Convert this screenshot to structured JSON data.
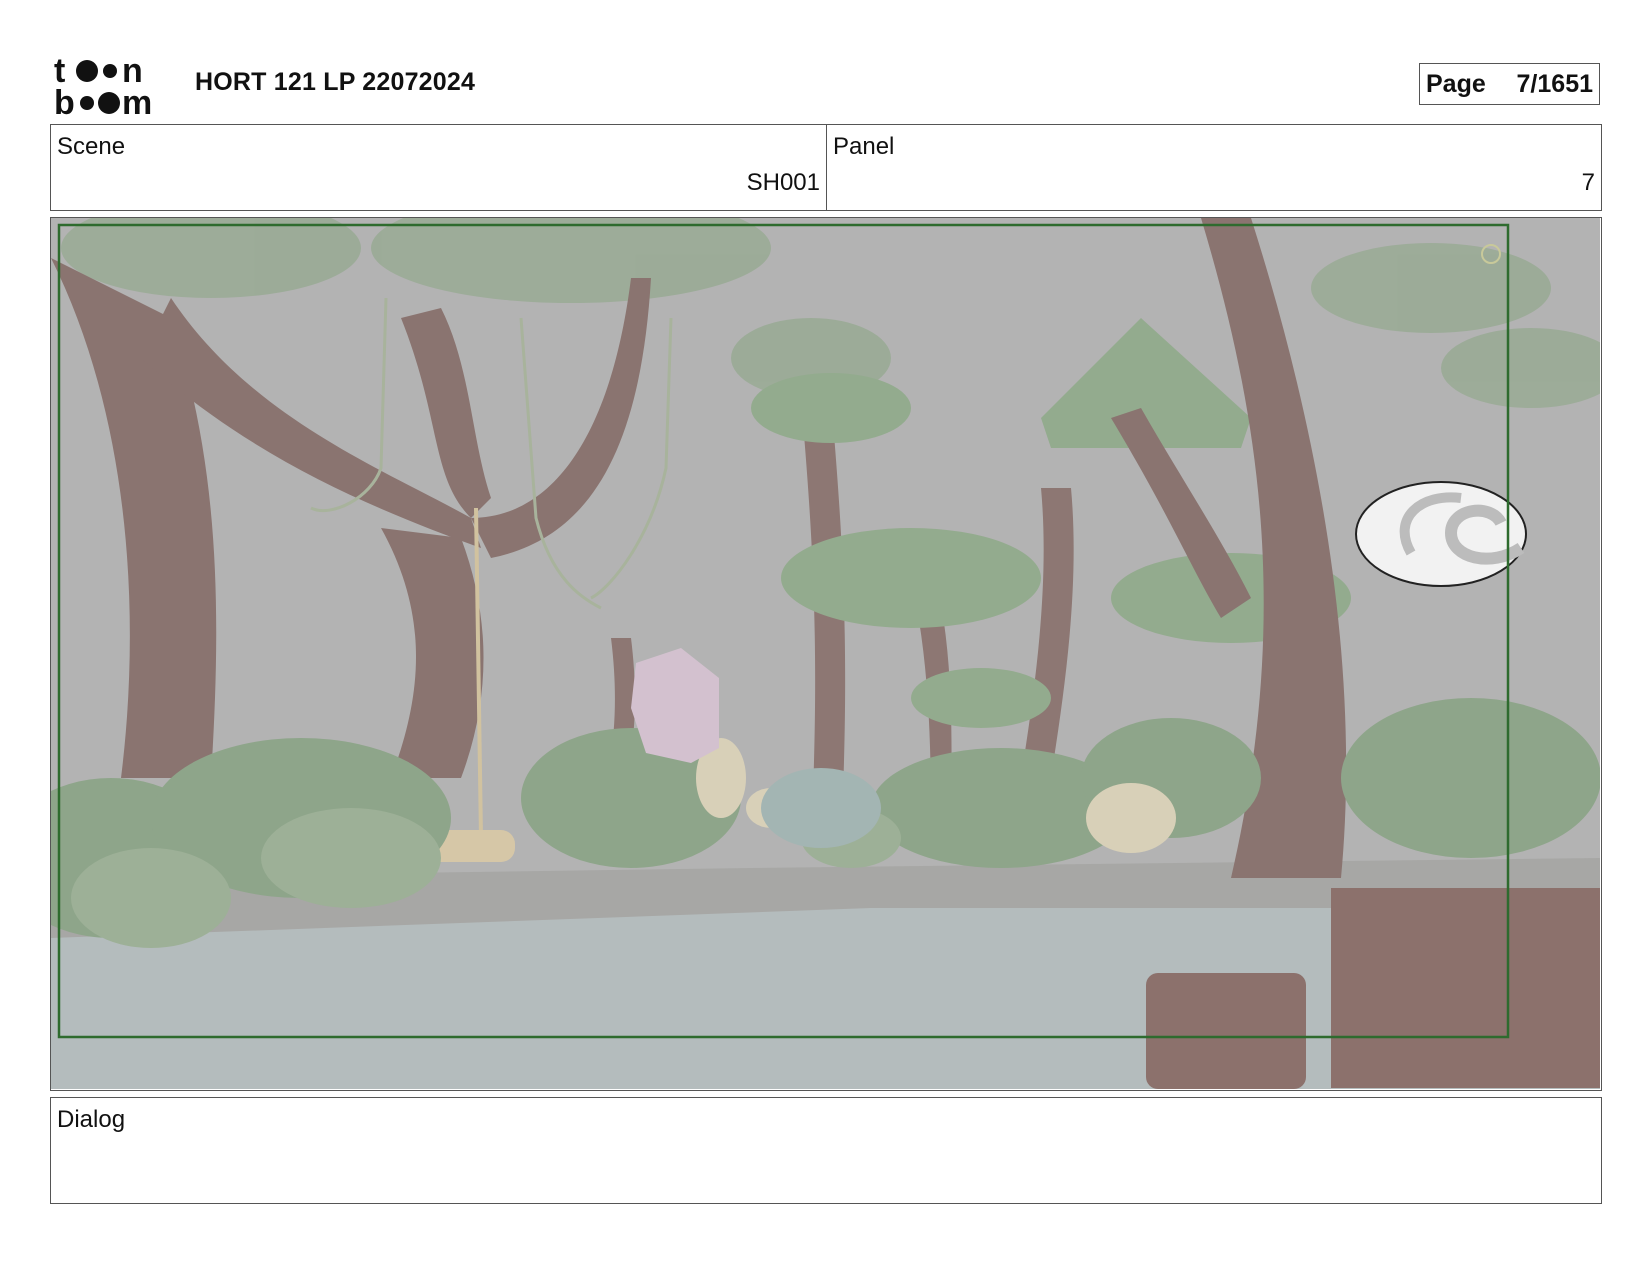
{
  "header": {
    "logo_text": "toon boom",
    "title": "HORT 121 LP 22072024",
    "page_label": "Page",
    "page_value": "7/1651"
  },
  "scene": {
    "label": "Scene",
    "value": "SH001"
  },
  "panel": {
    "label": "Panel",
    "value": "7"
  },
  "dialog": {
    "label": "Dialog",
    "value": ""
  },
  "colors": {
    "border": "#555555",
    "safe_frame": "#2e6b2e",
    "sky": "#b3b3b3",
    "ground": "#b4bcbd",
    "trunk": "#8d7773",
    "foliage": "#8fa88c"
  }
}
